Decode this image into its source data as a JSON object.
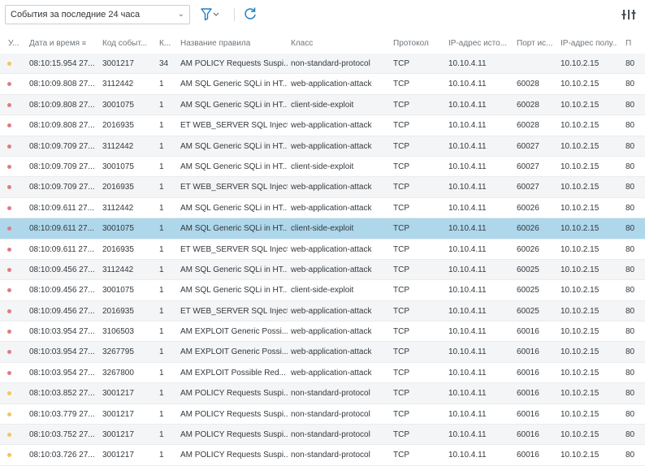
{
  "toolbar": {
    "period_value": "События за последние 24 часа",
    "filter_icon": "filter-icon",
    "refresh_icon": "refresh-icon",
    "columns_icon": "columns-settings-icon"
  },
  "colors": {
    "selected_row": "#aed7eb",
    "severity_high": "#e07b82",
    "severity_medium": "#f5c45a",
    "accent": "#1f7fc1"
  },
  "table": {
    "columns": [
      "У...",
      "Дата и время",
      "Код событ...",
      "К...",
      "Название правила",
      "Класс",
      "Протокол",
      "IP-адрес исто...",
      "Порт ис...",
      "IP-адрес полу...",
      "П"
    ],
    "rows": [
      {
        "sev": "medium",
        "time": "08:10:15.954 27...",
        "code": "3001217",
        "count": "34",
        "rule": "AM POLICY Requests Suspi...",
        "class": "non-standard-protocol",
        "proto": "TCP",
        "src_ip": "10.10.4.11",
        "src_port": "",
        "dst_ip": "10.10.2.15",
        "dst_port": "80"
      },
      {
        "sev": "high",
        "time": "08:10:09.808 27...",
        "code": "3112442",
        "count": "1",
        "rule": "AM SQL Generic SQLi in HT...",
        "class": "web-application-attack",
        "proto": "TCP",
        "src_ip": "10.10.4.11",
        "src_port": "60028",
        "dst_ip": "10.10.2.15",
        "dst_port": "80"
      },
      {
        "sev": "high",
        "time": "08:10:09.808 27...",
        "code": "3001075",
        "count": "1",
        "rule": "AM SQL Generic SQLi in HT...",
        "class": "client-side-exploit",
        "proto": "TCP",
        "src_ip": "10.10.4.11",
        "src_port": "60028",
        "dst_ip": "10.10.2.15",
        "dst_port": "80"
      },
      {
        "sev": "high",
        "time": "08:10:09.808 27...",
        "code": "2016935",
        "count": "1",
        "rule": "ET WEB_SERVER SQL Inject...",
        "class": "web-application-attack",
        "proto": "TCP",
        "src_ip": "10.10.4.11",
        "src_port": "60028",
        "dst_ip": "10.10.2.15",
        "dst_port": "80"
      },
      {
        "sev": "high",
        "time": "08:10:09.709 27...",
        "code": "3112442",
        "count": "1",
        "rule": "AM SQL Generic SQLi in HT...",
        "class": "web-application-attack",
        "proto": "TCP",
        "src_ip": "10.10.4.11",
        "src_port": "60027",
        "dst_ip": "10.10.2.15",
        "dst_port": "80"
      },
      {
        "sev": "high",
        "time": "08:10:09.709 27...",
        "code": "3001075",
        "count": "1",
        "rule": "AM SQL Generic SQLi in HT...",
        "class": "client-side-exploit",
        "proto": "TCP",
        "src_ip": "10.10.4.11",
        "src_port": "60027",
        "dst_ip": "10.10.2.15",
        "dst_port": "80"
      },
      {
        "sev": "high",
        "time": "08:10:09.709 27...",
        "code": "2016935",
        "count": "1",
        "rule": "ET WEB_SERVER SQL Inject...",
        "class": "web-application-attack",
        "proto": "TCP",
        "src_ip": "10.10.4.11",
        "src_port": "60027",
        "dst_ip": "10.10.2.15",
        "dst_port": "80"
      },
      {
        "sev": "high",
        "time": "08:10:09.611 27...",
        "code": "3112442",
        "count": "1",
        "rule": "AM SQL Generic SQLi in HT...",
        "class": "web-application-attack",
        "proto": "TCP",
        "src_ip": "10.10.4.11",
        "src_port": "60026",
        "dst_ip": "10.10.2.15",
        "dst_port": "80"
      },
      {
        "sev": "high",
        "time": "08:10:09.611 27...",
        "code": "3001075",
        "count": "1",
        "rule": "AM SQL Generic SQLi in HT...",
        "class": "client-side-exploit",
        "proto": "TCP",
        "src_ip": "10.10.4.11",
        "src_port": "60026",
        "dst_ip": "10.10.2.15",
        "dst_port": "80",
        "selected": true
      },
      {
        "sev": "high",
        "time": "08:10:09.611 27...",
        "code": "2016935",
        "count": "1",
        "rule": "ET WEB_SERVER SQL Inject...",
        "class": "web-application-attack",
        "proto": "TCP",
        "src_ip": "10.10.4.11",
        "src_port": "60026",
        "dst_ip": "10.10.2.15",
        "dst_port": "80"
      },
      {
        "sev": "high",
        "time": "08:10:09.456 27...",
        "code": "3112442",
        "count": "1",
        "rule": "AM SQL Generic SQLi in HT...",
        "class": "web-application-attack",
        "proto": "TCP",
        "src_ip": "10.10.4.11",
        "src_port": "60025",
        "dst_ip": "10.10.2.15",
        "dst_port": "80"
      },
      {
        "sev": "high",
        "time": "08:10:09.456 27...",
        "code": "3001075",
        "count": "1",
        "rule": "AM SQL Generic SQLi in HT...",
        "class": "client-side-exploit",
        "proto": "TCP",
        "src_ip": "10.10.4.11",
        "src_port": "60025",
        "dst_ip": "10.10.2.15",
        "dst_port": "80"
      },
      {
        "sev": "high",
        "time": "08:10:09.456 27...",
        "code": "2016935",
        "count": "1",
        "rule": "ET WEB_SERVER SQL Inject...",
        "class": "web-application-attack",
        "proto": "TCP",
        "src_ip": "10.10.4.11",
        "src_port": "60025",
        "dst_ip": "10.10.2.15",
        "dst_port": "80"
      },
      {
        "sev": "high",
        "time": "08:10:03.954 27...",
        "code": "3106503",
        "count": "1",
        "rule": "AM EXPLOIT Generic Possi...",
        "class": "web-application-attack",
        "proto": "TCP",
        "src_ip": "10.10.4.11",
        "src_port": "60016",
        "dst_ip": "10.10.2.15",
        "dst_port": "80"
      },
      {
        "sev": "high",
        "time": "08:10:03.954 27...",
        "code": "3267795",
        "count": "1",
        "rule": "AM EXPLOIT Generic Possi...",
        "class": "web-application-attack",
        "proto": "TCP",
        "src_ip": "10.10.4.11",
        "src_port": "60016",
        "dst_ip": "10.10.2.15",
        "dst_port": "80"
      },
      {
        "sev": "high",
        "time": "08:10:03.954 27...",
        "code": "3267800",
        "count": "1",
        "rule": "AM EXPLOIT Possible Red...",
        "class": "web-application-attack",
        "proto": "TCP",
        "src_ip": "10.10.4.11",
        "src_port": "60016",
        "dst_ip": "10.10.2.15",
        "dst_port": "80"
      },
      {
        "sev": "medium",
        "time": "08:10:03.852 27...",
        "code": "3001217",
        "count": "1",
        "rule": "AM POLICY Requests Suspi...",
        "class": "non-standard-protocol",
        "proto": "TCP",
        "src_ip": "10.10.4.11",
        "src_port": "60016",
        "dst_ip": "10.10.2.15",
        "dst_port": "80"
      },
      {
        "sev": "medium",
        "time": "08:10:03.779 27...",
        "code": "3001217",
        "count": "1",
        "rule": "AM POLICY Requests Suspi...",
        "class": "non-standard-protocol",
        "proto": "TCP",
        "src_ip": "10.10.4.11",
        "src_port": "60016",
        "dst_ip": "10.10.2.15",
        "dst_port": "80"
      },
      {
        "sev": "medium",
        "time": "08:10:03.752 27...",
        "code": "3001217",
        "count": "1",
        "rule": "AM POLICY Requests Suspi...",
        "class": "non-standard-protocol",
        "proto": "TCP",
        "src_ip": "10.10.4.11",
        "src_port": "60016",
        "dst_ip": "10.10.2.15",
        "dst_port": "80"
      },
      {
        "sev": "medium",
        "time": "08:10:03.726 27...",
        "code": "3001217",
        "count": "1",
        "rule": "AM POLICY Requests Suspi...",
        "class": "non-standard-protocol",
        "proto": "TCP",
        "src_ip": "10.10.4.11",
        "src_port": "60016",
        "dst_ip": "10.10.2.15",
        "dst_port": "80"
      }
    ]
  }
}
